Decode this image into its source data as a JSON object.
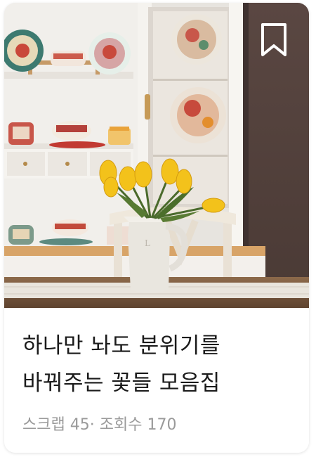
{
  "card": {
    "title": "하나만 놔도 분위기를 바꿔주는 꽃들 모음집",
    "image_alt": "흰 찬장 앞 테이블 위 노란 튤립 화병",
    "bookmark_icon": "bookmark-outline-icon"
  },
  "stats": {
    "scrap_label": "스크랩",
    "scrap_count": "45",
    "separator": "·",
    "views_label": "조회수",
    "views_count": "170"
  },
  "colors": {
    "title": "#1b1b1b",
    "meta": "#9a9a9a",
    "bookmark": "#ffffff",
    "tulip": "#f3c21b"
  }
}
